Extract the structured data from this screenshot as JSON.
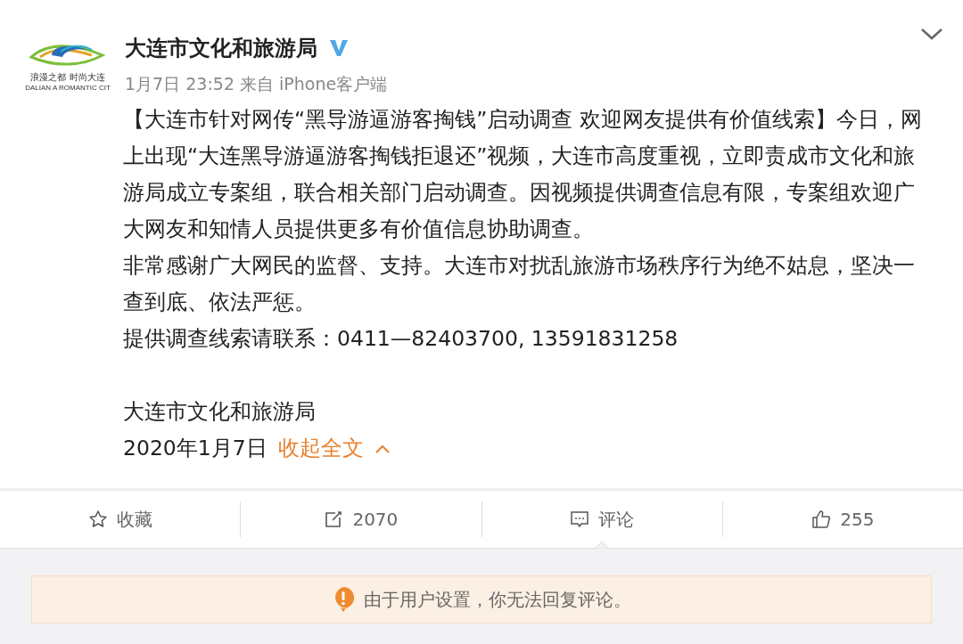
{
  "account": {
    "name": "大连市文化和旅游局",
    "verified": true,
    "logo_caption": "浪漫之都 时尚大连",
    "logo_subcaption": "DALIAN A ROMANTIC CIT",
    "meta": "1月7日 23:52 来自 iPhone客户端"
  },
  "post": {
    "paragraphs": [
      "【大连市针对网传“黑导游逼游客掏钱”启动调查 欢迎网友提供有价值线索】今日，网上出现“大连黑导游逼游客掏钱拒退还”视频，大连市高度重视，立即责成市文化和旅游局成立专案组，联合相关部门启动调查。因视频提供调查信息有限，专案组欢迎广大网友和知情人员提供更多有价值信息协助调查。",
      "非常感谢广大网民的监督、支持。大连市对扰乱旅游市场秩序行为绝不姑息，坚决一查到底、依法严惩。",
      "提供调查线索请联系：0411—82403700, 13591831258"
    ],
    "signature": "大连市文化和旅游局",
    "date": "2020年1月7日",
    "collapse_link": "收起全文"
  },
  "actions": [
    {
      "kind": "favorite",
      "label": "收藏",
      "selected": false
    },
    {
      "kind": "repost",
      "label": "2070",
      "selected": false
    },
    {
      "kind": "comment",
      "label": "评论",
      "selected": true
    },
    {
      "kind": "like",
      "label": "255",
      "selected": false
    }
  ],
  "notice": "由于用户设置，你无法回复评论。"
}
